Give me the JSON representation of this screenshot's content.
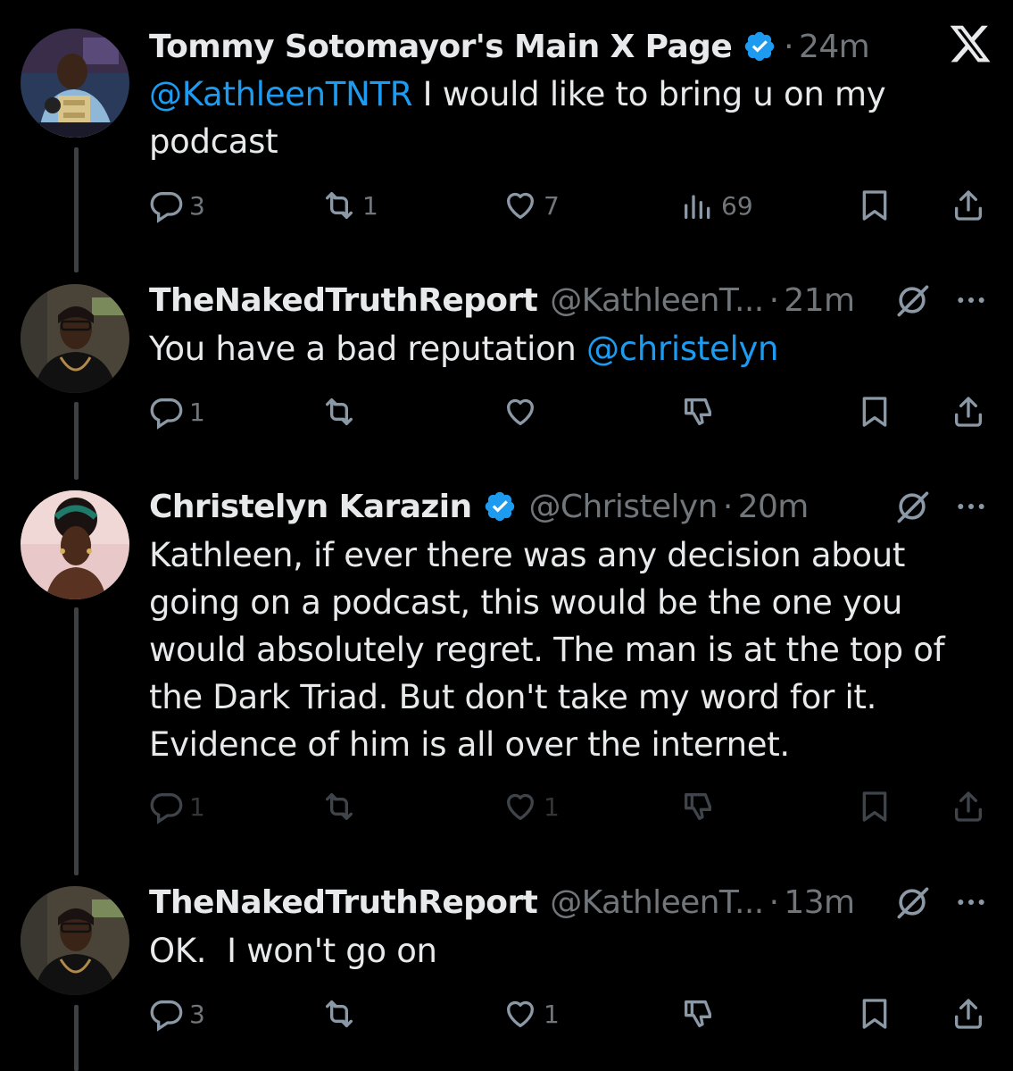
{
  "brand": {
    "logo": "x-logo-icon"
  },
  "tweets": [
    {
      "name": "Tommy Sotomayor's Main X Page",
      "verified": true,
      "handle": "",
      "dot": "·",
      "time": "24m",
      "text_segments": [
        {
          "mention": "@KathleenTNTR"
        },
        {
          "text": " I would like to bring u on my podcast"
        }
      ],
      "actions": {
        "replies": "3",
        "reposts": "1",
        "likes": "7",
        "views": "69"
      }
    },
    {
      "name": "TheNakedTruthReport",
      "verified": false,
      "handle": "@KathleenT...",
      "dot": "·",
      "time": "21m",
      "text_segments": [
        {
          "text": "You have a bad reputation "
        },
        {
          "mention": "@christelyn"
        }
      ],
      "actions": {
        "replies": "1",
        "reposts": "",
        "likes": ""
      }
    },
    {
      "name": "Christelyn Karazin",
      "verified": true,
      "handle": "@Christelyn",
      "dot": "·",
      "time": "20m",
      "text_segments": [
        {
          "text": "Kathleen, if ever there was any decision about going on a podcast, this would be the one you would absolutely regret. The man is at the top of the Dark Triad. But don't take my word for it. Evidence of him is all over the internet."
        }
      ],
      "actions": {
        "replies": "1",
        "reposts": "",
        "likes": "1"
      }
    },
    {
      "name": "TheNakedTruthReport",
      "verified": false,
      "handle": "@KathleenT...",
      "dot": "·",
      "time": "13m",
      "text_segments": [
        {
          "text": "OK.  I won't go on"
        }
      ],
      "actions": {
        "replies": "3",
        "reposts": "",
        "likes": "1"
      }
    }
  ]
}
